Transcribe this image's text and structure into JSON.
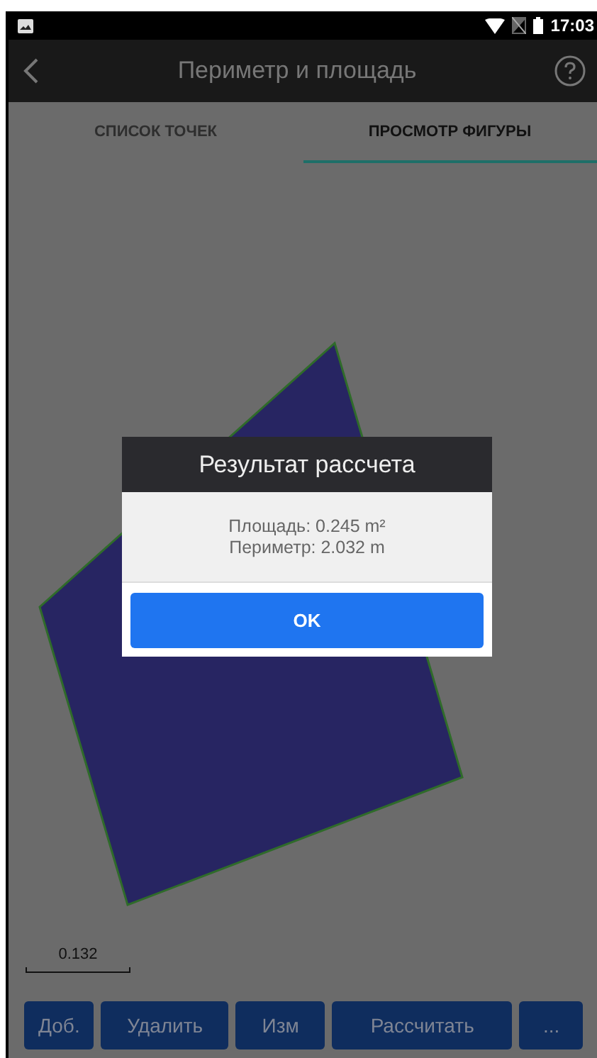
{
  "status_bar": {
    "time": "17:03"
  },
  "app_bar": {
    "title": "Периметр и площадь"
  },
  "tabs": [
    {
      "label": "СПИСОК ТОЧЕК",
      "selected": false
    },
    {
      "label": "ПРОСМОТР ФИГУРЫ",
      "selected": true
    }
  ],
  "scale": {
    "label": "0.132"
  },
  "dialog": {
    "title": "Результат рассчета",
    "lines": [
      "Площадь: 0.245 m²",
      "Периметр: 2.032 m"
    ],
    "button": "OK"
  },
  "buttons": [
    "Доб.",
    "Удалить",
    "Изм",
    "Рассчитать",
    "..."
  ]
}
